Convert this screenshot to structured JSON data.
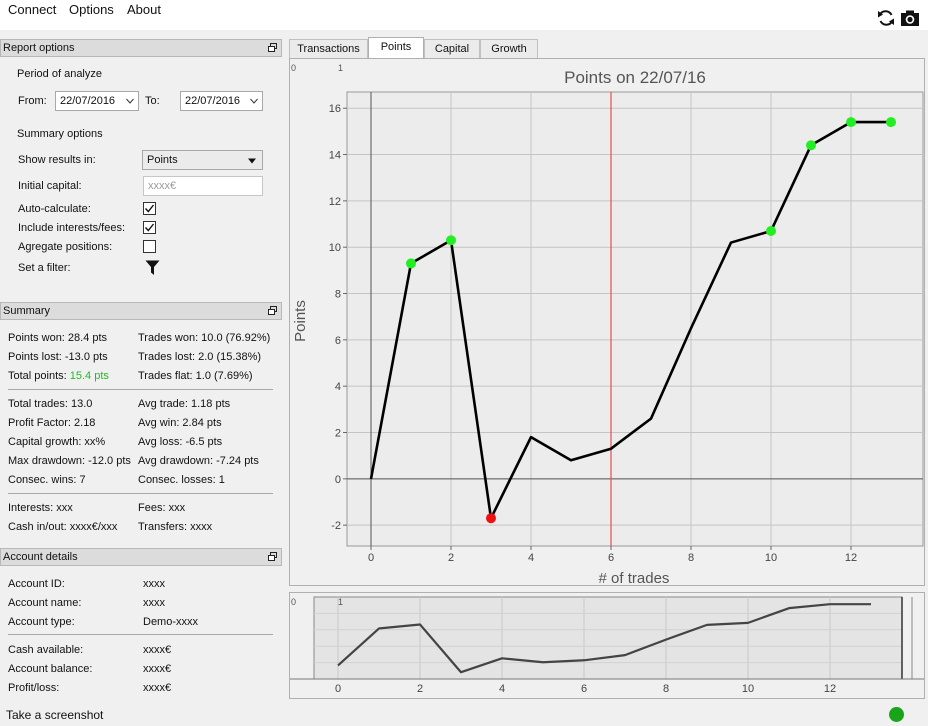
{
  "menu": {
    "connect": "Connect",
    "options": "Options",
    "about": "About"
  },
  "report_options": {
    "title": "Report options",
    "period_heading": "Period of analyze",
    "from_label": "From:",
    "from_value": "22/07/2016",
    "to_label": "To:",
    "to_value": "22/07/2016",
    "summary_heading": "Summary options",
    "show_results_label": "Show results in:",
    "show_results_value": "Points",
    "initial_capital_label": "Initial capital:",
    "initial_capital_placeholder": "xxxx€",
    "auto_calc_label": "Auto-calculate:",
    "auto_calc_checked": true,
    "include_fees_label": "Include interests/fees:",
    "include_fees_checked": true,
    "aggregate_label": "Agregate positions:",
    "aggregate_checked": false,
    "filter_label": "Set a filter:"
  },
  "summary": {
    "title": "Summary",
    "points_won": "Points won: 28.4 pts",
    "points_lost": "Points lost: -13.0 pts",
    "total_points_label": "Total points: ",
    "total_points_value": "15.4 pts",
    "trades_won": "Trades won: 10.0 (76.92%)",
    "trades_lost": "Trades lost: 2.0 (15.38%)",
    "trades_flat": "Trades flat: 1.0 (7.69%)",
    "total_trades": "Total trades: 13.0",
    "profit_factor": "Profit Factor: 2.18",
    "capital_growth": "Capital growth: xx%",
    "max_drawdown": "Max drawdown: -12.0 pts",
    "consec_wins": "Consec. wins: 7",
    "avg_trade": "Avg trade: 1.18 pts",
    "avg_win": "Avg win: 2.84 pts",
    "avg_loss": "Avg loss: -6.5 pts",
    "avg_drawdown": "Avg drawdown: -7.24 pts",
    "consec_losses": "Consec. losses: 1",
    "interests": "Interests: xxx",
    "fees": "Fees: xxx",
    "cash_in_out": "Cash in/out: xxxx€/xxx",
    "transfers": "Transfers: xxxx"
  },
  "account": {
    "title": "Account details",
    "id_label": "Account ID:",
    "id_value": "xxxx",
    "name_label": "Account name:",
    "name_value": "xxxx",
    "type_label": "Account type:",
    "type_value": "Demo-xxxx",
    "cash_label": "Cash available:",
    "cash_value": "xxxx€",
    "balance_label": "Account balance:",
    "balance_value": "xxxx€",
    "pl_label": "Profit/loss:",
    "pl_value": "xxxx€"
  },
  "tabs": [
    "Transactions",
    "Points",
    "Capital",
    "Growth"
  ],
  "active_tab": "Points",
  "status": {
    "screenshot_text": "Take a screenshot",
    "led_color": "#1aa41a"
  },
  "icons": {
    "refresh": "refresh-icon",
    "camera": "camera-icon",
    "filter": "filter-icon",
    "float": "float-window-icon"
  },
  "colors": {
    "win_marker": "#22ee22",
    "loss_marker": "#ee1111",
    "marker_line": "#e05050",
    "line": "#000000",
    "positive_text": "#22bb22"
  },
  "chart_data": {
    "type": "line",
    "title": "Points on 22/07/16",
    "xlabel": "# of trades",
    "ylabel": "Points",
    "corner_labels": [
      "0",
      "1"
    ],
    "xlim": [
      -0.6,
      13.8
    ],
    "ylim": [
      -2.9,
      16.7
    ],
    "xticks": [
      0,
      2,
      4,
      6,
      8,
      10,
      12
    ],
    "yticks": [
      -2,
      0,
      2,
      4,
      6,
      8,
      10,
      12,
      14,
      16
    ],
    "grid": true,
    "marker_x": 6,
    "x": [
      0,
      1,
      2,
      3,
      4,
      5,
      6,
      7,
      8,
      9,
      10,
      11,
      12,
      13
    ],
    "values": [
      0,
      9.3,
      10.3,
      -1.7,
      1.8,
      0.8,
      1.3,
      2.6,
      6.5,
      10.2,
      10.7,
      14.4,
      15.4,
      15.4
    ],
    "markers": [
      {
        "x": 1,
        "y": 9.3,
        "kind": "win"
      },
      {
        "x": 2,
        "y": 10.3,
        "kind": "win"
      },
      {
        "x": 3,
        "y": -1.7,
        "kind": "loss"
      },
      {
        "x": 10,
        "y": 10.7,
        "kind": "win"
      },
      {
        "x": 11,
        "y": 14.4,
        "kind": "win"
      },
      {
        "x": 12,
        "y": 15.4,
        "kind": "win"
      },
      {
        "x": 13,
        "y": 15.4,
        "kind": "win"
      }
    ]
  },
  "mini_chart": {
    "corner_labels": [
      "0",
      "1"
    ],
    "xticks": [
      0,
      2,
      4,
      6,
      8,
      10,
      12
    ]
  }
}
